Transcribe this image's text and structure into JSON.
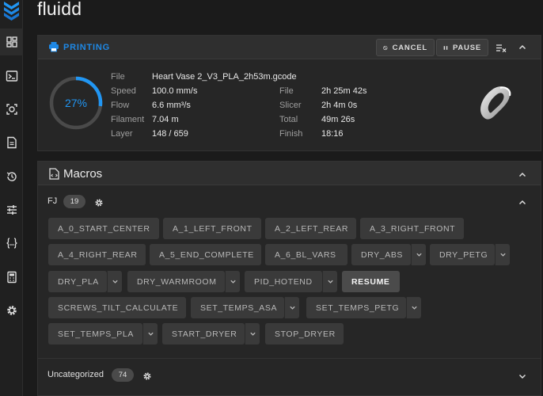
{
  "app": {
    "title": "fluidd"
  },
  "sidebar": {
    "items": [
      {
        "icon": "dashboard-icon"
      },
      {
        "icon": "console-icon"
      },
      {
        "icon": "camera-icon"
      },
      {
        "icon": "file-icon"
      },
      {
        "icon": "history-icon"
      },
      {
        "icon": "tune-icon"
      },
      {
        "icon": "code-braces-icon"
      },
      {
        "icon": "calculator-icon"
      },
      {
        "icon": "gear-icon"
      }
    ]
  },
  "status": {
    "state": "PRINTING",
    "cancel_label": "CANCEL",
    "pause_label": "PAUSE",
    "progress_percent": 27,
    "progress_text": "27%",
    "left": [
      {
        "key": "File",
        "value": "Heart Vase 2_V3_PLA_2h53m.gcode"
      },
      {
        "key": "Speed",
        "value": "100.0 mm/s"
      },
      {
        "key": "Flow",
        "value": "6.6 mm³/s"
      },
      {
        "key": "Filament",
        "value": "7.04 m"
      },
      {
        "key": "Layer",
        "value": "148 / 659"
      }
    ],
    "right": [
      {
        "key": "File",
        "value": "2h 25m 42s"
      },
      {
        "key": "Slicer",
        "value": "2h 4m 0s"
      },
      {
        "key": "Total",
        "value": "49m 26s"
      },
      {
        "key": "Finish",
        "value": "18:16"
      }
    ]
  },
  "macros": {
    "title": "Macros",
    "groups": [
      {
        "name": "FJ",
        "count": "19"
      },
      {
        "name": "Uncategorized",
        "count": "74"
      }
    ],
    "buttons": [
      "A_0_START_CENTER",
      "A_1_LEFT_FRONT",
      "A_2_LEFT_REAR",
      "A_3_RIGHT_FRONT",
      "A_4_RIGHT_REAR",
      "A_5_END_COMPLETE",
      "A_6_BL_VARS",
      "DRY_ABS",
      "DRY_PETG",
      "DRY_PLA",
      "DRY_WARMROOM",
      "PID_HOTEND",
      "RESUME",
      "SCREWS_TILT_CALCULATE",
      "SET_TEMPS_ASA",
      "SET_TEMPS_PETG",
      "SET_TEMPS_PLA",
      "START_DRYER",
      "STOP_DRYER"
    ]
  },
  "colors": {
    "accent": "#1e88e5",
    "background": "#1b1b1b",
    "card": "#262626"
  }
}
